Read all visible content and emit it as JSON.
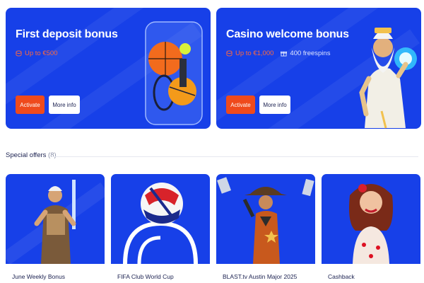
{
  "promos": [
    {
      "title": "First deposit bonus",
      "amount": "Up to €500",
      "activate_label": "Activate",
      "more_label": "More info",
      "art_icon": "sports-balls-bag-icon"
    },
    {
      "title": "Casino welcome bonus",
      "amount": "Up to €1,000",
      "spins": "400 freespins",
      "activate_label": "Activate",
      "more_label": "More info",
      "art_icon": "zeus-character-icon"
    }
  ],
  "special_offers": {
    "heading": "Special offers",
    "count": "(8)",
    "items": [
      {
        "label": "June Weekly Bonus",
        "icon": "warrior-sword-icon"
      },
      {
        "label": "FIFA Club World Cup",
        "icon": "football-icon"
      },
      {
        "label": "BLAST.tv Austin Major 2025",
        "icon": "cowboy-gunslinger-icon"
      },
      {
        "label": "Cashback",
        "icon": "pinup-woman-icon"
      }
    ]
  },
  "colors": {
    "brand_blue": "#1740e8",
    "accent_orange": "#ef4a1c",
    "amount_orange": "#ff6a3d",
    "text_dark": "#1b2150"
  }
}
